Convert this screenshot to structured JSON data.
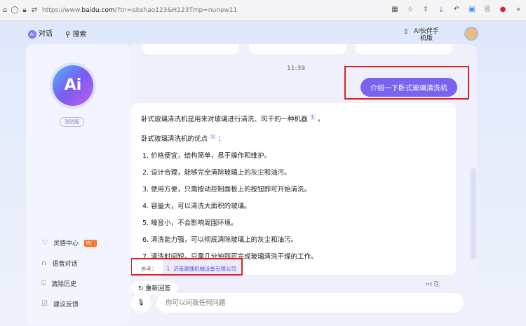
{
  "browser": {
    "url_prefix": "https://www.",
    "url_domain": "baidu.com",
    "url_rest": "/?tn=sitehao123&H123Tmp=nunew11"
  },
  "nav": {
    "chat": "对话",
    "search": "搜索",
    "logo": "Ai",
    "phone": "AI伙伴手机版"
  },
  "sidebar": {
    "logo": "Ai",
    "beta": "测试版",
    "items": [
      {
        "label": "灵感中心",
        "badge": "热门"
      },
      {
        "label": "语音对话"
      },
      {
        "label": "清除历史"
      },
      {
        "label": "建议反馈"
      }
    ]
  },
  "chat": {
    "time": "11:39",
    "question": "介绍一下卧式玻璃清洗机",
    "answer_intro": "卧式玻璃清洗机是用来对玻璃进行清洗、风干的一种机器",
    "answer_adv": "卧式玻璃清洗机的优点",
    "cite": "1",
    "points": [
      "1. 价格便宜，结构简单，易于操作和维护。",
      "2. 设计合理，能够完全清除玻璃上的灰尘和油污。",
      "3. 使用方便，只需按动控制面板上的按钮即可开始清洗。",
      "4. 容量大，可以清洗大面积的玻璃。",
      "5. 噪音小，不会影响周围环境。",
      "6. 清洗能力强，可以彻底清除玻璃上的灰尘和油污。",
      "7. 清洗时间短，只需几分钟即可完成玻璃清洗干燥的工作。"
    ],
    "ref_label": "参考：",
    "ref_num": "1",
    "ref_source": "济南康捷机械设备有限公司",
    "regen": "重新回答"
  },
  "input": {
    "placeholder": "你可以问我任何问题"
  },
  "colors": {
    "accent": "#7b63f0",
    "highlight": "#e02020"
  }
}
